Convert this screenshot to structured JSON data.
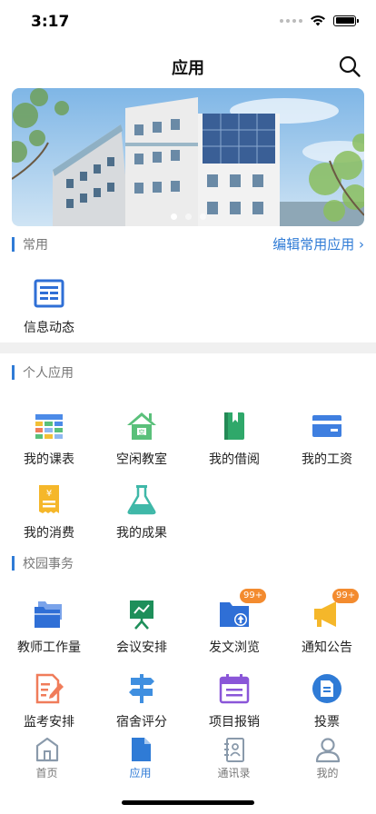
{
  "status": {
    "time": "3:17"
  },
  "header": {
    "title": "应用"
  },
  "banner": {
    "dots": 3,
    "active_index": 0
  },
  "common": {
    "title": "常用",
    "edit_label": "编辑常用应用 ›",
    "items": [
      {
        "label": "信息动态",
        "icon": "news-icon"
      }
    ]
  },
  "personal": {
    "title": "个人应用",
    "items": [
      {
        "label": "我的课表",
        "icon": "timetable-icon"
      },
      {
        "label": "空闲教室",
        "icon": "classroom-icon"
      },
      {
        "label": "我的借阅",
        "icon": "book-icon"
      },
      {
        "label": "我的工资",
        "icon": "salary-card-icon"
      },
      {
        "label": "我的消费",
        "icon": "receipt-icon"
      },
      {
        "label": "我的成果",
        "icon": "flask-icon"
      }
    ]
  },
  "campus": {
    "title": "校园事务",
    "items": [
      {
        "label": "教师工作量",
        "icon": "folders-icon"
      },
      {
        "label": "会议安排",
        "icon": "presentation-icon"
      },
      {
        "label": "发文浏览",
        "icon": "folder-upload-icon",
        "badge": "99+"
      },
      {
        "label": "通知公告",
        "icon": "megaphone-icon",
        "badge": "99+"
      },
      {
        "label": "监考安排",
        "icon": "exam-edit-icon"
      },
      {
        "label": "宿舍评分",
        "icon": "signpost-icon"
      },
      {
        "label": "项目报销",
        "icon": "calendar-icon"
      },
      {
        "label": "投票",
        "icon": "vote-icon"
      }
    ]
  },
  "tabs": [
    {
      "label": "首页",
      "icon": "home-icon"
    },
    {
      "label": "应用",
      "icon": "apps-doc-icon"
    },
    {
      "label": "通讯录",
      "icon": "contacts-icon"
    },
    {
      "label": "我的",
      "icon": "profile-icon"
    }
  ],
  "active_tab": "应用",
  "colors": {
    "accent": "#2f7bd6",
    "badge": "#f38b2f",
    "divider": "#f0f0f0"
  }
}
